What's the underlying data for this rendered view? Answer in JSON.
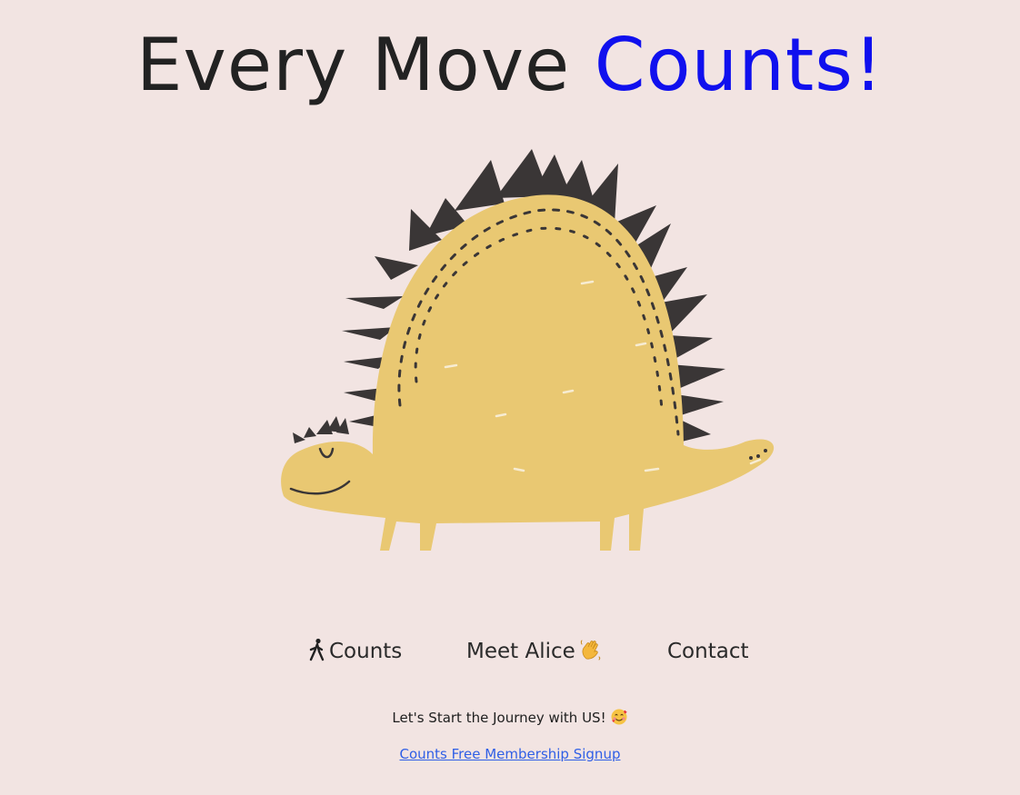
{
  "page": {
    "headline_part1": "Every Move",
    "headline_part2": "Counts!",
    "accent_color": "#1010ee",
    "background_color": "#f2e4e2"
  },
  "hero": {
    "image": "yellow-dinosaur-illustration",
    "body_color": "#e9c872",
    "spike_color": "#3a3636"
  },
  "nav": {
    "items": [
      {
        "icon": "person-walking-icon",
        "label": "Counts"
      },
      {
        "label": "Meet Alice",
        "icon": "waving-hand-icon"
      },
      {
        "label": "Contact"
      }
    ]
  },
  "cta": {
    "tagline": "Let's Start the Journey with US!",
    "tagline_icon": "smiling-face-with-hearts-icon",
    "signup_link": "Counts Free Membership Signup",
    "link_color": "#2f5fe6"
  }
}
